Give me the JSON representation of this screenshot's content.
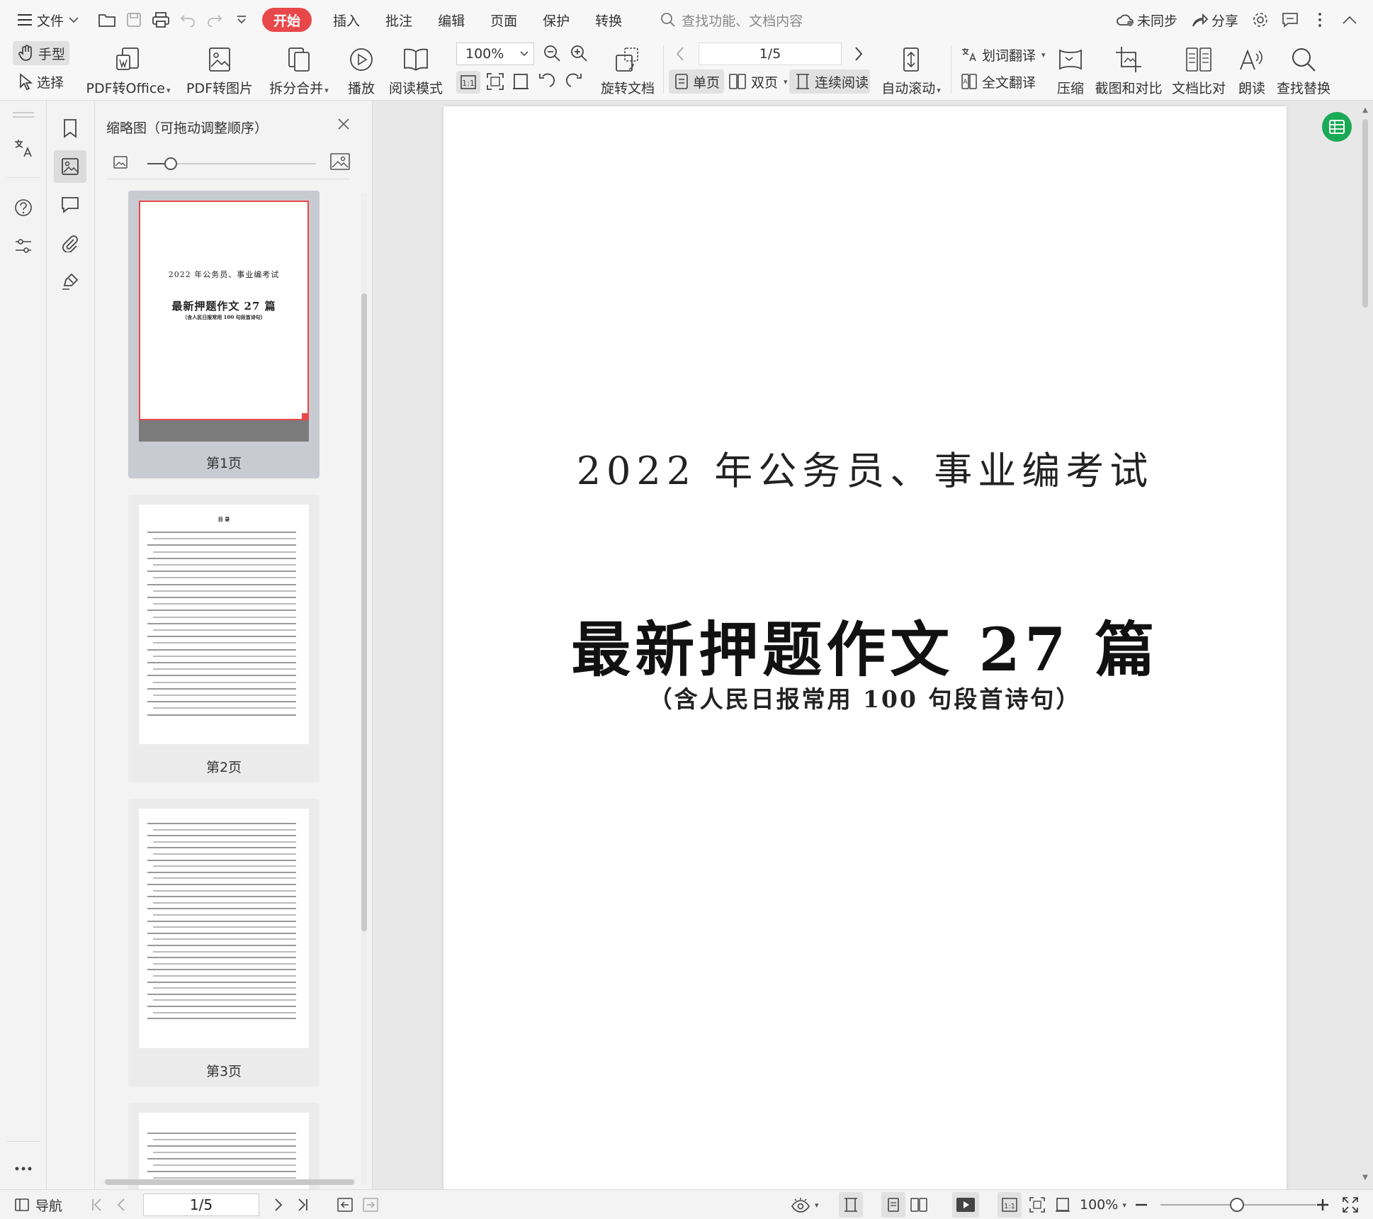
{
  "menubar": {
    "file_label": "文件",
    "tabs": [
      {
        "label": "开始",
        "active": true
      },
      {
        "label": "插入",
        "active": false
      },
      {
        "label": "批注",
        "active": false
      },
      {
        "label": "编辑",
        "active": false
      },
      {
        "label": "页面",
        "active": false
      },
      {
        "label": "保护",
        "active": false
      },
      {
        "label": "转换",
        "active": false
      }
    ],
    "search_placeholder": "查找功能、文档内容",
    "sync_label": "未同步",
    "share_label": "分享"
  },
  "toolbar": {
    "hand_label": "手型",
    "select_label": "选择",
    "pdf_to_office": "PDF转Office",
    "pdf_to_image": "PDF转图片",
    "split_merge": "拆分合并",
    "play": "播放",
    "read_mode": "阅读模式",
    "zoom_value": "100%",
    "rotate_doc": "旋转文档",
    "page_value": "1/5",
    "single_page": "单页",
    "double_page": "双页",
    "continuous_read": "连续阅读",
    "auto_scroll": "自动滚动",
    "word_translate": "划词翻译",
    "full_translate": "全文翻译",
    "compress": "压缩",
    "screenshot_compare": "截图和对比",
    "doc_compare": "文档比对",
    "read_aloud": "朗读",
    "find_replace": "查找替换"
  },
  "thumbs": {
    "title": "缩略图（可拖动调整顺序）",
    "pages": [
      {
        "label": "第1页",
        "selected": true
      },
      {
        "label": "第2页",
        "selected": false
      },
      {
        "label": "第3页",
        "selected": false
      }
    ],
    "p1_line1": "2022 年公务员、事业编考试",
    "p1_line2": "最新押题作文 27 篇",
    "p1_line3": "（含人民日报常用 100 句段首诗句）",
    "p2_title": "目 录"
  },
  "document": {
    "line1": "2022 年公务员、事业编考试",
    "line2": "最新押题作文 27 篇",
    "line3": "（含人民日报常用 100 句段首诗句）"
  },
  "statusbar": {
    "nav_label": "导航",
    "page_value": "1/5",
    "zoom_value": "100%"
  },
  "colors": {
    "accent_red": "#e8484a",
    "thumb_selected_border": "#e8484a",
    "green_badge": "#1aaa55"
  }
}
